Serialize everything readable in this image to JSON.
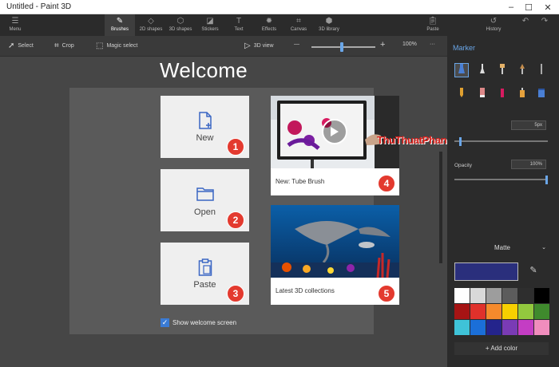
{
  "window": {
    "title": "Untitled - Paint 3D",
    "controls": [
      "–",
      "☐",
      "✕"
    ]
  },
  "ribbon": {
    "menu": {
      "label": "Menu",
      "icon": "hamburger-icon"
    },
    "tabs": [
      {
        "label": "Brushes",
        "icon": "brush-icon"
      },
      {
        "label": "2D shapes",
        "icon": "2d-shapes-icon"
      },
      {
        "label": "3D shapes",
        "icon": "cube-icon"
      },
      {
        "label": "Stickers",
        "icon": "sticker-icon"
      },
      {
        "label": "Text",
        "icon": "text-icon"
      },
      {
        "label": "Effects",
        "icon": "sun-icon"
      },
      {
        "label": "Canvas",
        "icon": "canvas-icon"
      },
      {
        "label": "3D library",
        "icon": "library-icon"
      }
    ],
    "paste": {
      "label": "Paste"
    },
    "history": {
      "label": "History"
    }
  },
  "toolbar": {
    "select": "Select",
    "crop": "Crop",
    "magic_select": "Magic select",
    "view_3d": "3D view",
    "zoom_minus": "—",
    "zoom_plus": "+",
    "zoom": "100%",
    "more": "···",
    "zoom_level": 0.45
  },
  "welcome": {
    "title": "Welcome",
    "cards": [
      {
        "label": "New",
        "badge": "1",
        "icon": "new-file-icon"
      },
      {
        "label": "Open",
        "badge": "2",
        "icon": "folder-icon"
      },
      {
        "label": "Paste",
        "badge": "3",
        "icon": "clipboard-icon"
      }
    ],
    "media": [
      {
        "caption": "New: Tube Brush",
        "badge": "4",
        "icon": "play-icon"
      },
      {
        "caption": "Latest 3D collections",
        "badge": "5"
      }
    ],
    "show_welcome": "Show welcome screen"
  },
  "watermark": "ThuThuatPhanMem.vn",
  "right_panel": {
    "title": "Marker",
    "thickness": "5px",
    "opacity_label": "Opacity",
    "opacity": "100%",
    "thickness_level": 0.05,
    "opacity_level": 1.0,
    "finish": "Matte",
    "add_color": "+ Add color",
    "selected_color": "#2a2f7c",
    "palette": [
      "#ffffff",
      "#d9d9d9",
      "#9d9d9d",
      "#5c5c5c",
      "#2e2e2e",
      "#000000",
      "#a61414",
      "#e0312b",
      "#f58a2c",
      "#f7d000",
      "#92c83e",
      "#3f8a2d",
      "#3fc3d8",
      "#1b6fd8",
      "#24248c",
      "#7a3bb5",
      "#c43dc4",
      "#f08dbd"
    ]
  },
  "colors": {
    "accent": "#6aa6e8",
    "badge": "#e33a2f",
    "watermark": "#d9201b"
  }
}
